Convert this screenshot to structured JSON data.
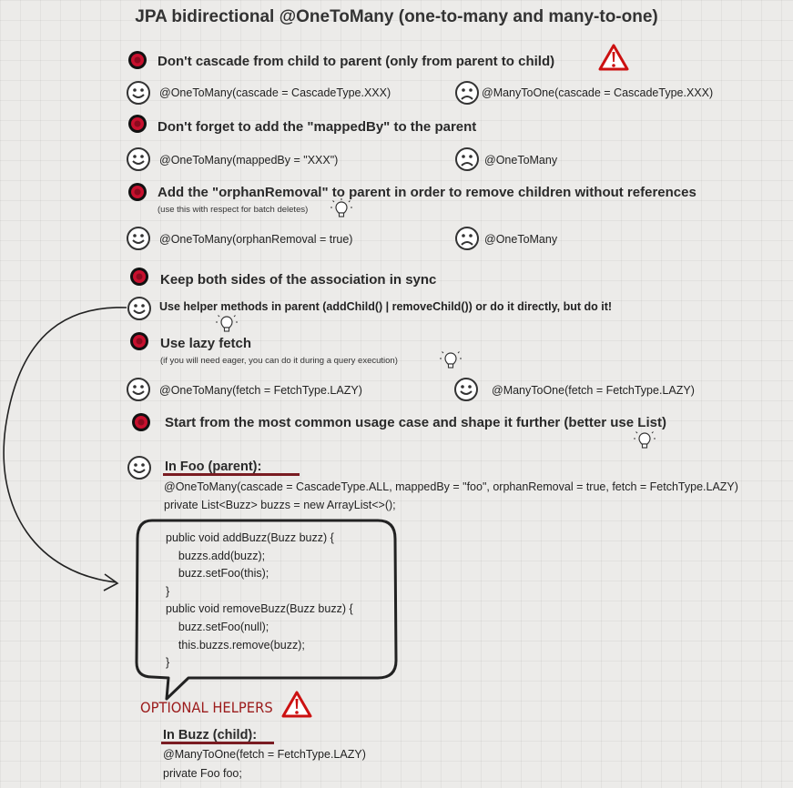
{
  "title": "JPA bidirectional @OneToMany (one-to-many and many-to-one)",
  "rules": [
    {
      "heading": "Don't cascade from child to parent (only from parent to child)",
      "good": "@OneToMany(cascade = CascadeType.XXX)",
      "bad": "@ManyToOne(cascade = CascadeType.XXX)"
    },
    {
      "heading": "Don't forget to add the \"mappedBy\" to the parent",
      "good": "@OneToMany(mappedBy = \"XXX\")",
      "bad": "@OneToMany"
    },
    {
      "heading": "Add the \"orphanRemoval\" to parent in order to remove children without references",
      "note": "(use this with respect for batch deletes)",
      "good": "@OneToMany(orphanRemoval = true)",
      "bad": "@OneToMany"
    },
    {
      "heading": "Keep both sides of the association in sync",
      "good": "Use helper methods in parent (addChild() | removeChild()) or do it directly, but do it!"
    },
    {
      "heading": "Use lazy fetch",
      "note": "(if you will need eager, you can do it during a query execution)",
      "good": "@OneToMany(fetch = FetchType.LAZY)",
      "good2": "@ManyToOne(fetch = FetchType.LAZY)"
    },
    {
      "heading": "Start from the most common usage case and shape it further (better use List)"
    }
  ],
  "parent": {
    "heading": "In Foo (parent):",
    "line1": "@OneToMany(cascade = CascadeType.ALL, mappedBy = \"foo\", orphanRemoval = true, fetch = FetchType.LAZY)",
    "line2": "private List<Buzz> buzzs = new ArrayList<>();"
  },
  "helpers_code": [
    "public void addBuzz(Buzz buzz) {",
    "    buzzs.add(buzz);",
    "    buzz.setFoo(this);",
    "}",
    "public void removeBuzz(Buzz buzz) {",
    "    buzz.setFoo(null);",
    "    this.buzzs.remove(buzz);",
    "}"
  ],
  "optional_label": "OPTIONAL HELPERS",
  "child": {
    "heading": "In Buzz (child):",
    "line1": "@ManyToOne(fetch = FetchType.LAZY)",
    "line2": "private Foo foo;"
  },
  "colors": {
    "bullet_red": "#c8102e",
    "underline": "#7a1c22",
    "warning_red": "#cc1111",
    "optional_text": "#9b1b1b"
  },
  "icons": [
    "red-bullet-icon",
    "happy-face-icon",
    "sad-face-icon",
    "lightbulb-icon",
    "warning-triangle-icon",
    "curved-arrow-icon"
  ]
}
